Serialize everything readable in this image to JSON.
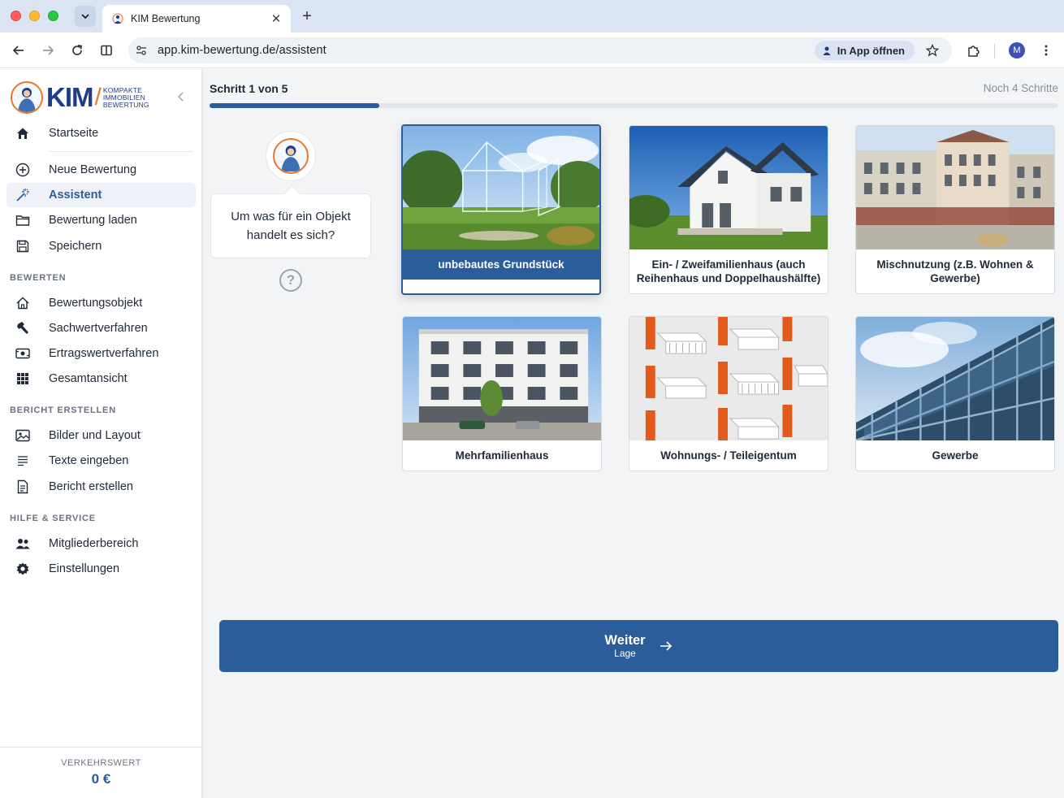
{
  "browser": {
    "tab_title": "KIM Bewertung",
    "url": "app.kim-bewertung.de/assistent",
    "open_in_app": "In App öffnen",
    "profile_initial": "M"
  },
  "sidebar": {
    "logo": {
      "name": "KIM",
      "tagline_1": "KOMPAKTE",
      "tagline_2": "IMMOBILIEN",
      "tagline_3": "BEWERTUNG"
    },
    "top_items": [
      {
        "label": "Startseite",
        "icon": "home-icon"
      }
    ],
    "items": [
      {
        "label": "Neue Bewertung",
        "icon": "plus-circle-icon"
      },
      {
        "label": "Assistent",
        "icon": "magic-wand-icon",
        "active": true
      },
      {
        "label": "Bewertung laden",
        "icon": "folder-icon"
      },
      {
        "label": "Speichern",
        "icon": "save-icon"
      }
    ],
    "section_bewerten": "BEWERTEN",
    "bewerten_items": [
      {
        "label": "Bewertungsobjekt",
        "icon": "house-outline-icon"
      },
      {
        "label": "Sachwertverfahren",
        "icon": "hammer-icon"
      },
      {
        "label": "Ertragswertverfahren",
        "icon": "money-icon"
      },
      {
        "label": "Gesamtansicht",
        "icon": "grid-icon"
      }
    ],
    "section_bericht": "BERICHT ERSTELLEN",
    "bericht_items": [
      {
        "label": "Bilder und Layout",
        "icon": "image-icon"
      },
      {
        "label": "Texte eingeben",
        "icon": "text-lines-icon"
      },
      {
        "label": "Bericht erstellen",
        "icon": "document-icon"
      }
    ],
    "section_hilfe": "HILFE & SERVICE",
    "hilfe_items": [
      {
        "label": "Mitgliederbereich",
        "icon": "users-icon"
      },
      {
        "label": "Einstellungen",
        "icon": "gear-icon"
      }
    ],
    "footer": {
      "label": "VERKEHRSWERT",
      "value": "0 €"
    }
  },
  "wizard": {
    "step_label": "Schritt 1 von 5",
    "remaining_label": "Noch 4 Schritte",
    "progress": 0.2,
    "question": "Um was für ein Objekt handelt es sich?",
    "help": "?",
    "options": [
      {
        "label": "unbebautes Grundstück",
        "selected": true
      },
      {
        "label": "Ein- / Zweifamilienhaus (auch Reihenhaus und Doppelhaushälfte)",
        "selected": false
      },
      {
        "label": "Mischnutzung (z.B. Wohnen & Gewerbe)",
        "selected": false
      },
      {
        "label": "Mehrfamilienhaus",
        "selected": false
      },
      {
        "label": "Wohnungs- / Teileigentum",
        "selected": false
      },
      {
        "label": "Gewerbe",
        "selected": false
      }
    ],
    "next_label": "Weiter",
    "next_sub": "Lage"
  },
  "colors": {
    "primary": "#2c5d9b",
    "accent_orange": "#e37a2e"
  }
}
